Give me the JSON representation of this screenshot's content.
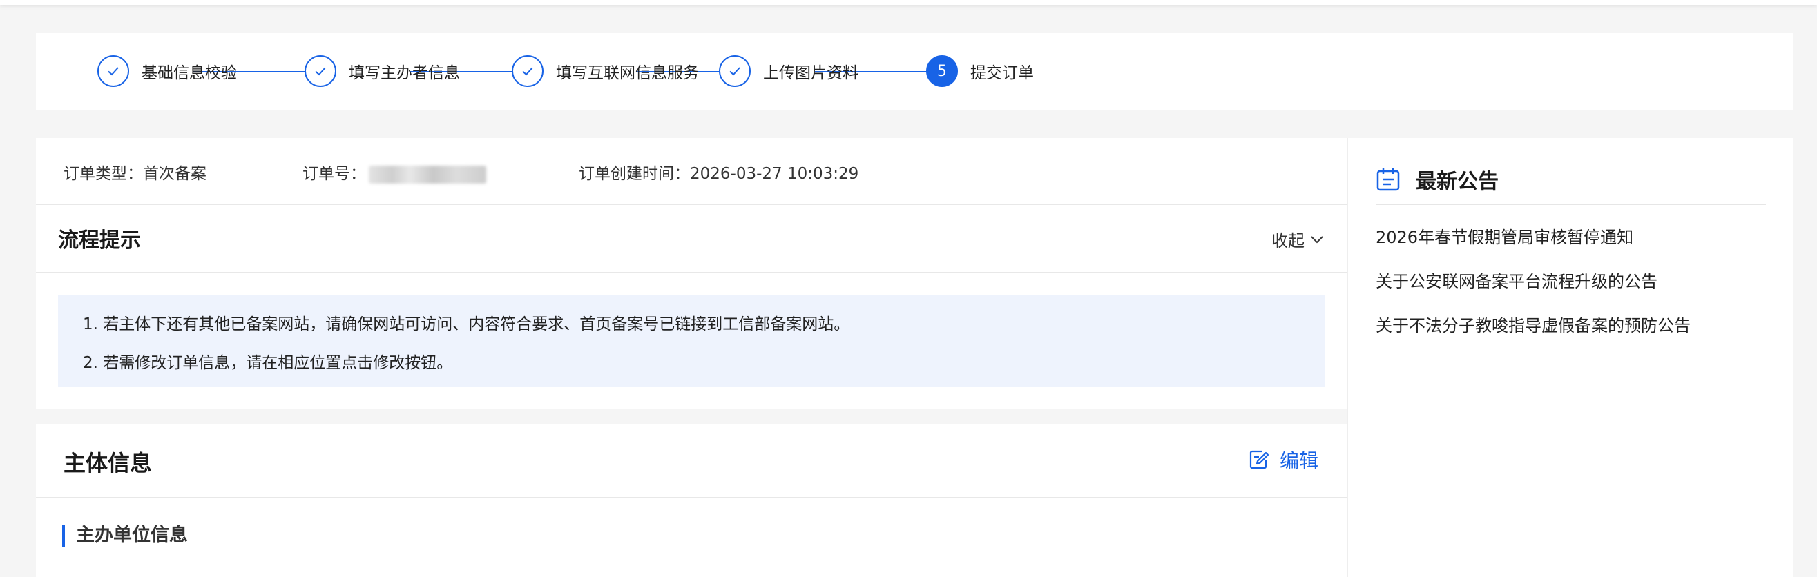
{
  "steps": [
    {
      "label": "基础信息校验",
      "status": "done"
    },
    {
      "label": "填写主办者信息",
      "status": "done"
    },
    {
      "label": "填写互联网信息服务",
      "status": "done"
    },
    {
      "label": "上传图片资料",
      "status": "done"
    },
    {
      "label": "提交订单",
      "status": "active",
      "number": "5"
    }
  ],
  "order": {
    "type_label": "订单类型：",
    "type_value": "首次备案",
    "number_label": "订单号：",
    "created_label": "订单创建时间：",
    "created_value": "2026-03-27 10:03:29"
  },
  "flow": {
    "title": "流程提示",
    "collapse_label": "收起",
    "tips": [
      "1. 若主体下还有其他已备案网站，请确保网站可访问、内容符合要求、首页备案号已链接到工信部备案网站。",
      "2. 若需修改订单信息，请在相应位置点击修改按钮。"
    ]
  },
  "notices": {
    "title": "最新公告",
    "items": [
      "2026年春节假期管局审核暂停通知",
      "关于公安联网备案平台流程升级的公告",
      "关于不法分子教唆指导虚假备案的预防公告"
    ]
  },
  "entity": {
    "title": "主体信息",
    "edit_label": "编辑",
    "subsection_title": "主办单位信息"
  },
  "colors": {
    "accent": "#1863e6",
    "tips_background": "#eef3fd",
    "page_background": "#f5f5f5"
  }
}
